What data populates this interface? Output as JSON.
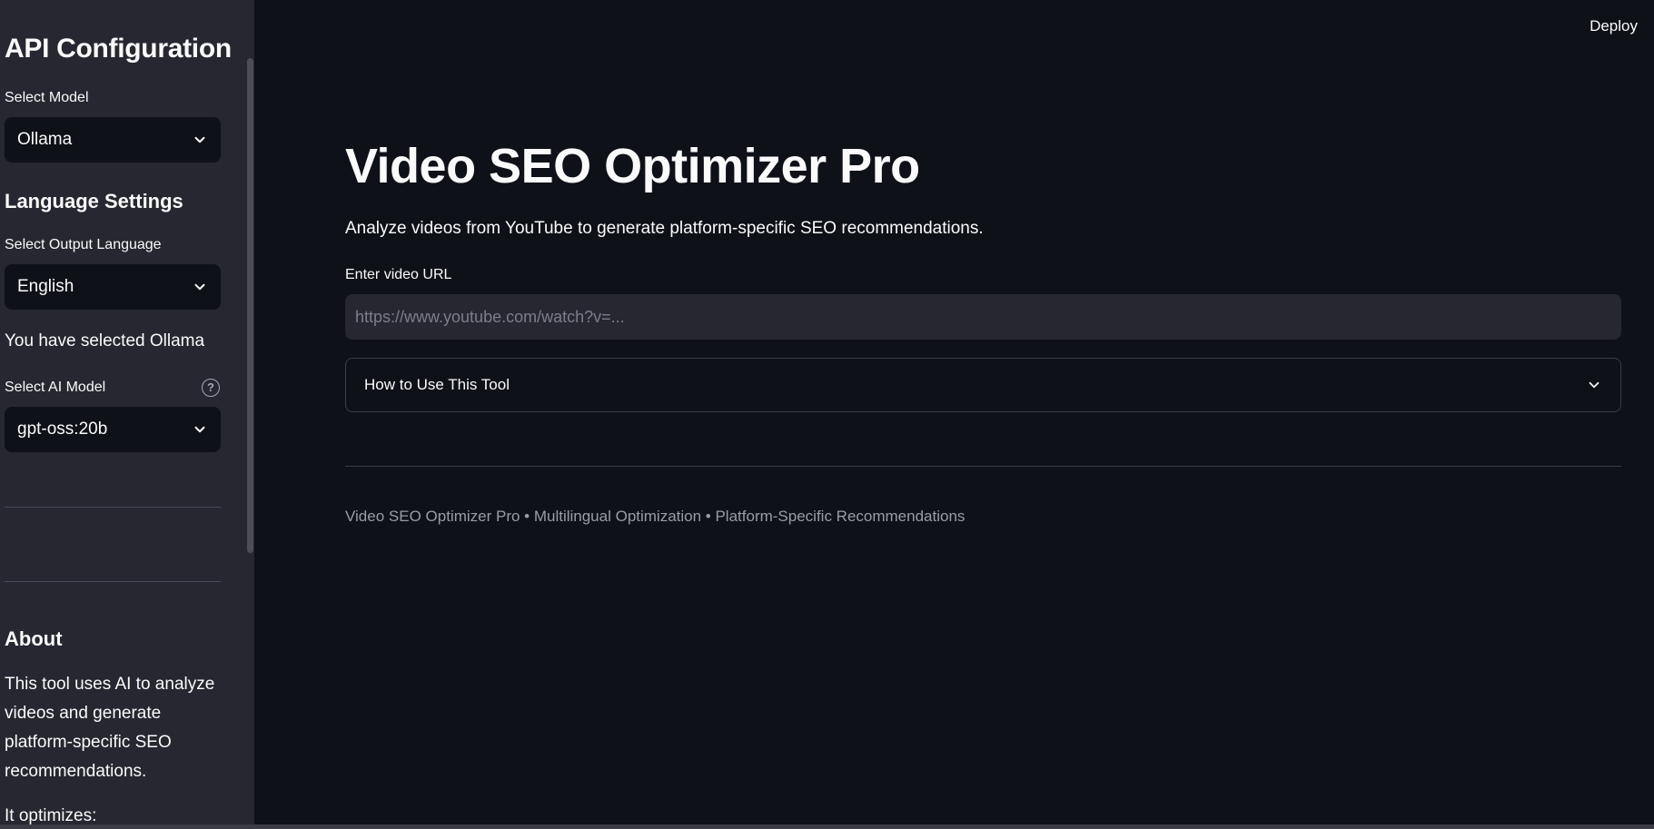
{
  "sidebar": {
    "api_heading": "API Configuration",
    "model_label": "Select Model",
    "model_value": "Ollama",
    "language_heading": "Language Settings",
    "language_label": "Select Output Language",
    "language_value": "English",
    "selected_text": "You have selected Ollama",
    "ai_model_label": "Select AI Model",
    "ai_model_value": "gpt-oss:20b",
    "help_glyph": "?",
    "about_heading": "About",
    "about_text": "This tool uses AI to analyze videos and generate platform-specific SEO recommendations.",
    "optimizes_text": "It optimizes:"
  },
  "header": {
    "deploy_label": "Deploy"
  },
  "main": {
    "title": "Video SEO Optimizer Pro",
    "subtitle": "Analyze videos from YouTube to generate platform-specific SEO recommendations.",
    "url_label": "Enter video URL",
    "url_placeholder": "https://www.youtube.com/watch?v=...",
    "url_value": "",
    "expander_label": "How to Use This Tool",
    "footer": "Video SEO Optimizer Pro • Multilingual Optimization • Platform-Specific Recommendations"
  },
  "icons": {
    "chevron": "chevron-down-icon",
    "help": "help-circle-icon"
  },
  "colors": {
    "background": "#0e1117",
    "sidebar_background": "#262730",
    "text": "#fafafa",
    "muted_text": "#9a9ca6"
  }
}
